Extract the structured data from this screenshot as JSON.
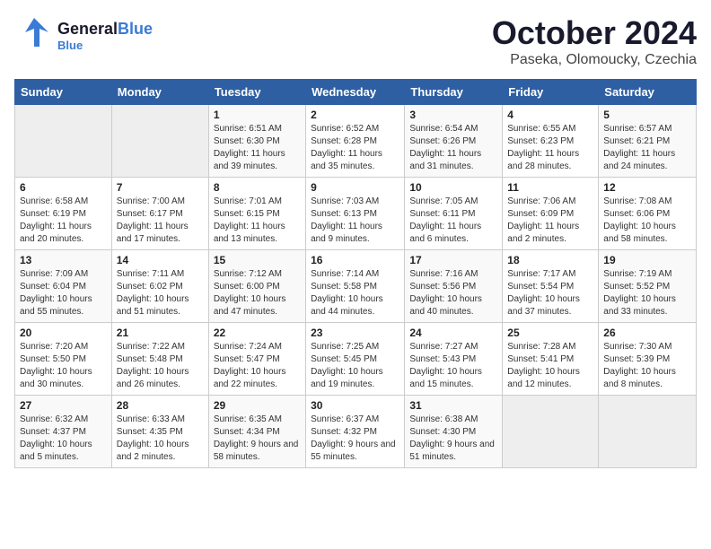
{
  "header": {
    "logo_general": "General",
    "logo_blue": "Blue",
    "title": "October 2024",
    "subtitle": "Paseka, Olomoucky, Czechia"
  },
  "columns": [
    "Sunday",
    "Monday",
    "Tuesday",
    "Wednesday",
    "Thursday",
    "Friday",
    "Saturday"
  ],
  "weeks": [
    [
      {
        "day": "",
        "info": ""
      },
      {
        "day": "",
        "info": ""
      },
      {
        "day": "1",
        "info": "Sunrise: 6:51 AM\nSunset: 6:30 PM\nDaylight: 11 hours and 39 minutes."
      },
      {
        "day": "2",
        "info": "Sunrise: 6:52 AM\nSunset: 6:28 PM\nDaylight: 11 hours and 35 minutes."
      },
      {
        "day": "3",
        "info": "Sunrise: 6:54 AM\nSunset: 6:26 PM\nDaylight: 11 hours and 31 minutes."
      },
      {
        "day": "4",
        "info": "Sunrise: 6:55 AM\nSunset: 6:23 PM\nDaylight: 11 hours and 28 minutes."
      },
      {
        "day": "5",
        "info": "Sunrise: 6:57 AM\nSunset: 6:21 PM\nDaylight: 11 hours and 24 minutes."
      }
    ],
    [
      {
        "day": "6",
        "info": "Sunrise: 6:58 AM\nSunset: 6:19 PM\nDaylight: 11 hours and 20 minutes."
      },
      {
        "day": "7",
        "info": "Sunrise: 7:00 AM\nSunset: 6:17 PM\nDaylight: 11 hours and 17 minutes."
      },
      {
        "day": "8",
        "info": "Sunrise: 7:01 AM\nSunset: 6:15 PM\nDaylight: 11 hours and 13 minutes."
      },
      {
        "day": "9",
        "info": "Sunrise: 7:03 AM\nSunset: 6:13 PM\nDaylight: 11 hours and 9 minutes."
      },
      {
        "day": "10",
        "info": "Sunrise: 7:05 AM\nSunset: 6:11 PM\nDaylight: 11 hours and 6 minutes."
      },
      {
        "day": "11",
        "info": "Sunrise: 7:06 AM\nSunset: 6:09 PM\nDaylight: 11 hours and 2 minutes."
      },
      {
        "day": "12",
        "info": "Sunrise: 7:08 AM\nSunset: 6:06 PM\nDaylight: 10 hours and 58 minutes."
      }
    ],
    [
      {
        "day": "13",
        "info": "Sunrise: 7:09 AM\nSunset: 6:04 PM\nDaylight: 10 hours and 55 minutes."
      },
      {
        "day": "14",
        "info": "Sunrise: 7:11 AM\nSunset: 6:02 PM\nDaylight: 10 hours and 51 minutes."
      },
      {
        "day": "15",
        "info": "Sunrise: 7:12 AM\nSunset: 6:00 PM\nDaylight: 10 hours and 47 minutes."
      },
      {
        "day": "16",
        "info": "Sunrise: 7:14 AM\nSunset: 5:58 PM\nDaylight: 10 hours and 44 minutes."
      },
      {
        "day": "17",
        "info": "Sunrise: 7:16 AM\nSunset: 5:56 PM\nDaylight: 10 hours and 40 minutes."
      },
      {
        "day": "18",
        "info": "Sunrise: 7:17 AM\nSunset: 5:54 PM\nDaylight: 10 hours and 37 minutes."
      },
      {
        "day": "19",
        "info": "Sunrise: 7:19 AM\nSunset: 5:52 PM\nDaylight: 10 hours and 33 minutes."
      }
    ],
    [
      {
        "day": "20",
        "info": "Sunrise: 7:20 AM\nSunset: 5:50 PM\nDaylight: 10 hours and 30 minutes."
      },
      {
        "day": "21",
        "info": "Sunrise: 7:22 AM\nSunset: 5:48 PM\nDaylight: 10 hours and 26 minutes."
      },
      {
        "day": "22",
        "info": "Sunrise: 7:24 AM\nSunset: 5:47 PM\nDaylight: 10 hours and 22 minutes."
      },
      {
        "day": "23",
        "info": "Sunrise: 7:25 AM\nSunset: 5:45 PM\nDaylight: 10 hours and 19 minutes."
      },
      {
        "day": "24",
        "info": "Sunrise: 7:27 AM\nSunset: 5:43 PM\nDaylight: 10 hours and 15 minutes."
      },
      {
        "day": "25",
        "info": "Sunrise: 7:28 AM\nSunset: 5:41 PM\nDaylight: 10 hours and 12 minutes."
      },
      {
        "day": "26",
        "info": "Sunrise: 7:30 AM\nSunset: 5:39 PM\nDaylight: 10 hours and 8 minutes."
      }
    ],
    [
      {
        "day": "27",
        "info": "Sunrise: 6:32 AM\nSunset: 4:37 PM\nDaylight: 10 hours and 5 minutes."
      },
      {
        "day": "28",
        "info": "Sunrise: 6:33 AM\nSunset: 4:35 PM\nDaylight: 10 hours and 2 minutes."
      },
      {
        "day": "29",
        "info": "Sunrise: 6:35 AM\nSunset: 4:34 PM\nDaylight: 9 hours and 58 minutes."
      },
      {
        "day": "30",
        "info": "Sunrise: 6:37 AM\nSunset: 4:32 PM\nDaylight: 9 hours and 55 minutes."
      },
      {
        "day": "31",
        "info": "Sunrise: 6:38 AM\nSunset: 4:30 PM\nDaylight: 9 hours and 51 minutes."
      },
      {
        "day": "",
        "info": ""
      },
      {
        "day": "",
        "info": ""
      }
    ]
  ]
}
